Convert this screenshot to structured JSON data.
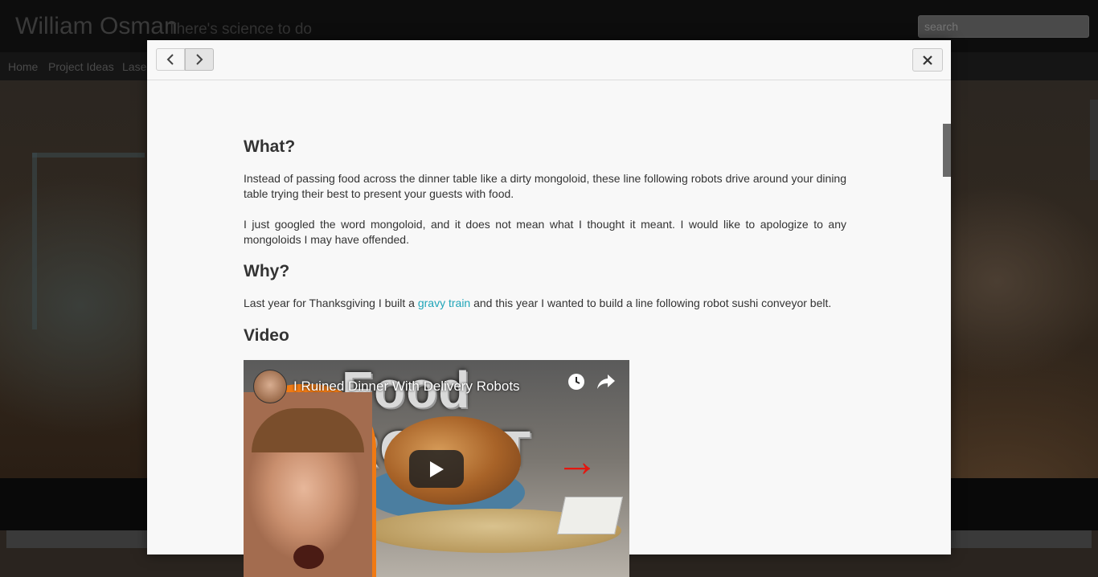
{
  "site": {
    "title": "William Osman",
    "tagline": "There's science to do",
    "search_placeholder": "search",
    "nav": [
      "Home",
      "Project Ideas",
      "Lase"
    ]
  },
  "modal": {
    "sections": [
      {
        "heading": "What?",
        "paragraphs": [
          "Instead of passing food across the dinner table like a dirty mongoloid, these line following robots drive around your dining table trying their best to present your guests with food.",
          "I just googled the word mongoloid, and it does not mean what I thought it meant. I would like to apologize to any mongoloids I may have offended."
        ]
      },
      {
        "heading": "Why?",
        "text_before_link": "Last year for Thanksgiving I built a ",
        "link_text": "gravy train",
        "text_after_link": " and this year I wanted to build a line following robot sushi conveyor belt."
      },
      {
        "heading": "Video"
      }
    ],
    "video": {
      "title": "I Ruined Dinner With Delivery Robots",
      "thumbnail_text": "Food ROBOT"
    }
  },
  "colors": {
    "link": "#1fa5b8",
    "modal_bg": "#f8f8f8",
    "text": "#333333"
  },
  "icons": {
    "prev": "chevron-left-icon",
    "next": "chevron-right-icon",
    "close": "close-icon",
    "clock": "watch-later-icon",
    "share": "share-icon",
    "play": "play-icon"
  }
}
